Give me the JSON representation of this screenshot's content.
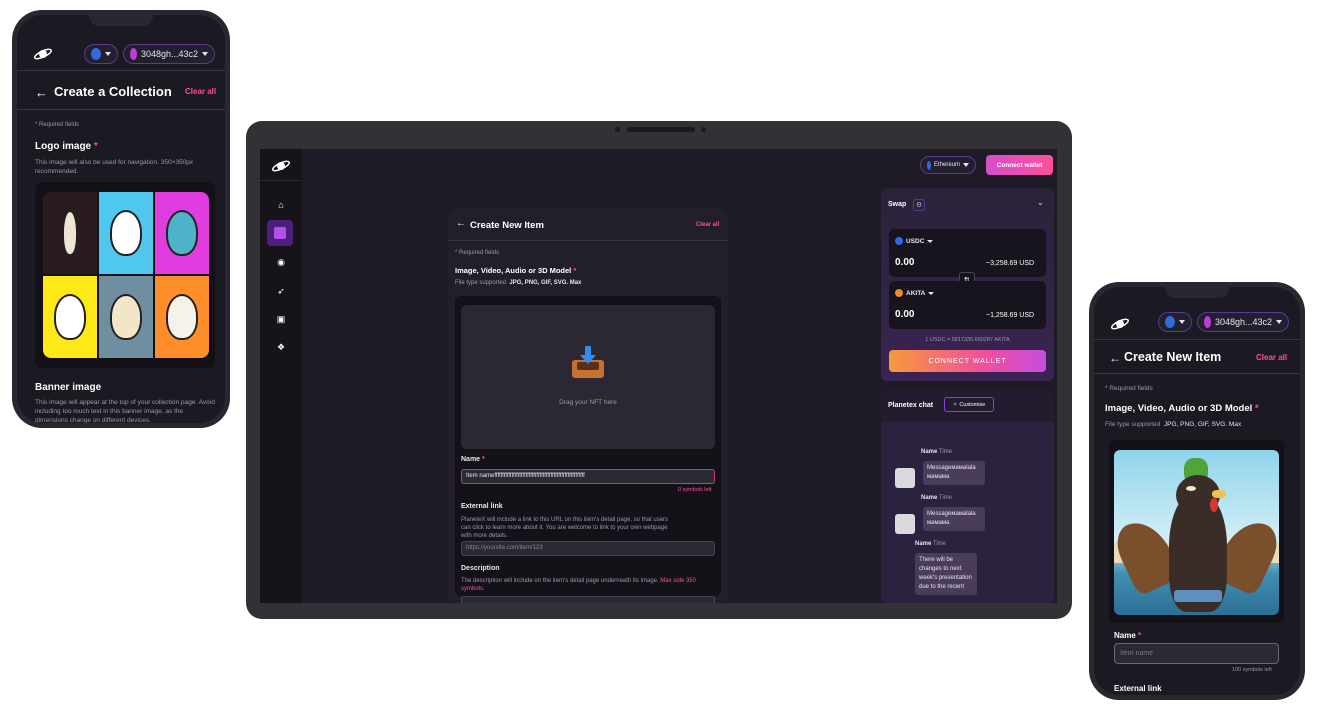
{
  "left_phone": {
    "network_pill": "",
    "wallet_address": "3048gh...43c2",
    "title": "Create a Collection",
    "clear_all": "Clear all",
    "required_note": "* Required fields",
    "logo_label": "Logo image",
    "logo_required": "*",
    "logo_desc": "This image will also be used for navigation. 350×350px recommended.",
    "banner_label": "Banner image",
    "banner_desc": "This image will appear at the top of your collection page. Avoid including too much text in this banner image, as the dimensions change on different devices."
  },
  "laptop": {
    "network": "Ethereum",
    "connect_wallet": "Connect wallet",
    "form": {
      "title": "Create New Item",
      "clear_all": "Clear all",
      "required_note": "* Required fields",
      "media_label": "Image, Video, Audio or 3D Model",
      "required_star": "*",
      "filetypes_label": "File type supported",
      "filetypes": "JPG, PNG, GIF, SVG. Max",
      "dropzone": "Drag your NFT here",
      "name_label": "Name",
      "name_value": "Item nameffffffffffffffffffffffffffffffffffffffffffffffffffffffffff",
      "symbols_left": "0 symbols left",
      "external_label": "External link",
      "external_desc": "PlanetеX will include a link to this URL on this item's detail page, so that users can click to learn more about it. You are welcome to link to your own webpage with more details.",
      "external_placeholder": "https://yoursite.com/item/123",
      "description_label": "Description",
      "description_desc": "The description will include on the item's detail page underneath its image.",
      "description_max": "Max side 350 symbols."
    },
    "swap": {
      "title": "Swap",
      "from_token": "USDC",
      "from_amount": "0.00",
      "from_usd": "~3,258.69 USD",
      "to_token": "AKITA",
      "to_amount": "0.00",
      "to_usd": "~1,258.69 USD",
      "rate": "1 USDC = 5817335.660287 AKITA",
      "connect_button": "CONNECT WALLET"
    },
    "chat": {
      "title": "Planetex chat",
      "customise": "Customise",
      "messages": [
        {
          "name": "Name",
          "time": "Time",
          "text": "Messageмамаlala мамама"
        },
        {
          "name": "Name",
          "time": "Time",
          "text": "Messageмамаlala мамама"
        },
        {
          "name": "Name",
          "time": "Time",
          "text": "There will be changes to next week's presentation due to the recent"
        }
      ]
    }
  },
  "right_phone": {
    "wallet_address": "3048gh...43c2",
    "title": "Create New Item",
    "clear_all": "Clear all",
    "required_note": "* Required fields",
    "media_label": "Image, Video, Audio or 3D Model",
    "required_star": "*",
    "filetypes_label": "File type supported",
    "filetypes": "JPG, PNG, GIF, SVG. Max",
    "name_label": "Name",
    "name_placeholder": "Item name",
    "symbols_left": "100 symbols left",
    "external_label": "External link"
  },
  "colors": {
    "accent_pink": "#ff4f9a",
    "accent_purple": "#8b3fe0",
    "bg_dark": "#1b1921"
  }
}
